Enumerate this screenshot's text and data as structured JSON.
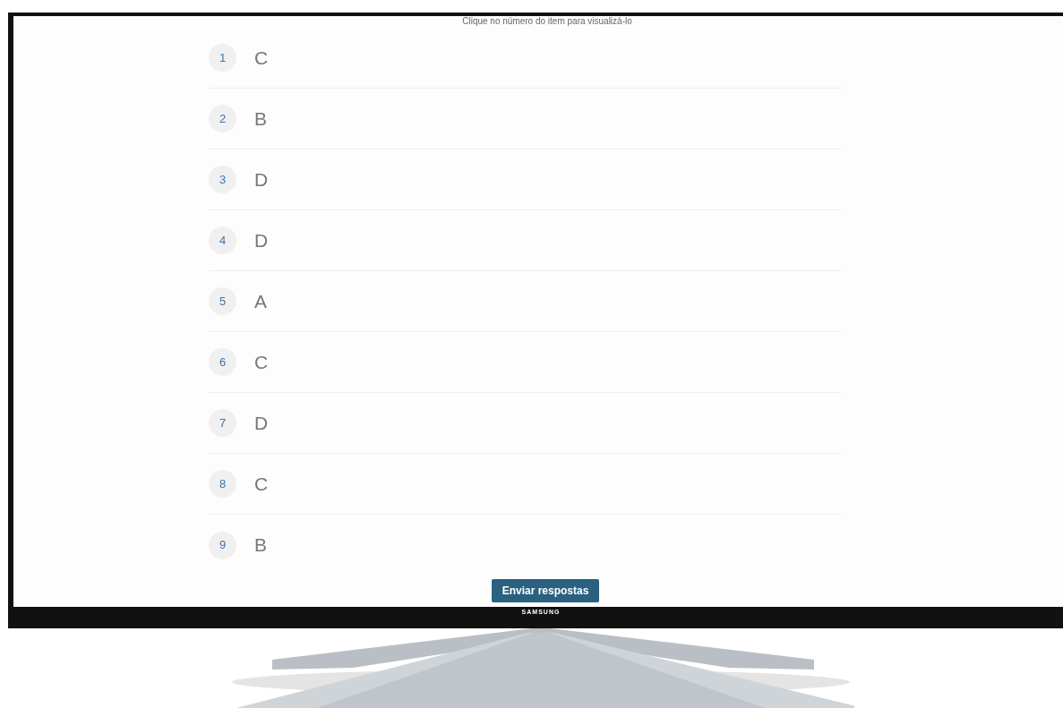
{
  "instruction": "Clique no número do item para visualizá-lo",
  "answers": [
    {
      "number": "1",
      "answer": "C"
    },
    {
      "number": "2",
      "answer": "B"
    },
    {
      "number": "3",
      "answer": "D"
    },
    {
      "number": "4",
      "answer": "D"
    },
    {
      "number": "5",
      "answer": "A"
    },
    {
      "number": "6",
      "answer": "C"
    },
    {
      "number": "7",
      "answer": "D"
    },
    {
      "number": "8",
      "answer": "C"
    },
    {
      "number": "9",
      "answer": "B"
    }
  ],
  "submit_button": "Enviar respostas",
  "brand_logo": "SAMSUNG"
}
